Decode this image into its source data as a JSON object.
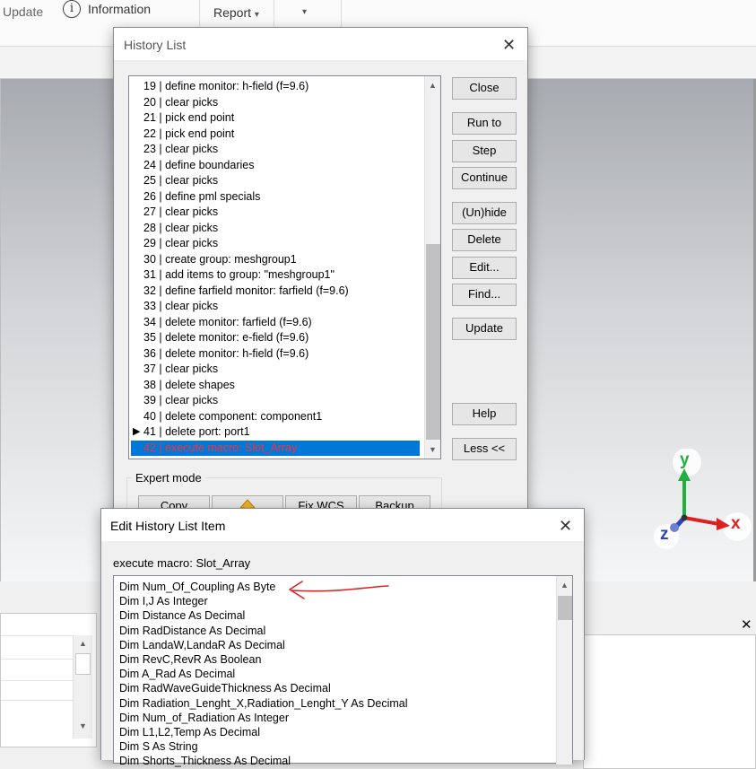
{
  "ribbon": {
    "update_label": "Update",
    "information_label": "Information",
    "report_label": "Report",
    "report_arrow": "▾",
    "more_arrow": "▾",
    "info_glyph": "i"
  },
  "history_dialog": {
    "title": "History List",
    "close_glyph": "✕",
    "items": [
      "19 | define monitor: h-field (f=9.6)",
      "20 | clear picks",
      "21 | pick end point",
      "22 | pick end point",
      "23 | clear picks",
      "24 | define boundaries",
      "25 | clear picks",
      "26 | define pml specials",
      "27 | clear picks",
      "28 | clear picks",
      "29 | clear picks",
      "30 | create group: meshgroup1",
      "31 | add items to group: \"meshgroup1\"",
      "32 | define farfield monitor: farfield (f=9.6)",
      "33 | clear picks",
      "34 | delete monitor: farfield (f=9.6)",
      "35 | delete monitor: e-field (f=9.6)",
      "36 | delete monitor: h-field (f=9.6)",
      "37 | clear picks",
      "38 | delete shapes",
      "39 | clear picks",
      "40 | delete component: component1",
      "41 | delete port: port1",
      "42 | execute macro: Slot_Array"
    ],
    "current_marker": "▶",
    "buttons": {
      "close": "Close",
      "run_to": "Run to",
      "step": "Step",
      "continue": "Continue",
      "unhide": "(Un)hide",
      "delete": "Delete",
      "edit": "Edit...",
      "find": "Find...",
      "update": "Update",
      "help": "Help",
      "less": "Less <<"
    },
    "expert_mode_label": "Expert mode",
    "expert_buttons": {
      "copy": "Copy",
      "fix_wcs": "Fix WCS",
      "backup": "Backup"
    },
    "scroll_up": "▲",
    "scroll_down": "▼"
  },
  "edit_dialog": {
    "title": "Edit History List Item",
    "close_glyph": "✕",
    "header": "execute macro: Slot_Array",
    "code_lines": [
      "Dim Num_Of_Coupling As Byte",
      "Dim I,J As Integer",
      "Dim Distance As Decimal",
      "Dim RadDistance As Decimal",
      "Dim LandaW,LandaR As Decimal",
      "Dim RevC,RevR As Boolean",
      "Dim A_Rad As Decimal",
      "Dim RadWaveGuideThickness As Decimal",
      "Dim Radiation_Lenght_X,Radiation_Lenght_Y As Decimal",
      "Dim Num_of_Radiation As Integer",
      "Dim L1,L2,Temp As Decimal",
      "Dim S As String",
      "Dim Shorts_Thickness As Decimal"
    ],
    "scroll_up": "▲"
  },
  "axes": {
    "x_label": "x",
    "y_label": "y",
    "z_label": "z",
    "x_color": "#e02020",
    "y_color": "#20b040",
    "z_color": "#3040c0"
  },
  "bottom_panels": {
    "close_glyph": "✕",
    "scroll_up": "▲",
    "scroll_down": "▼"
  },
  "annotation": {
    "color": "#e02020"
  }
}
